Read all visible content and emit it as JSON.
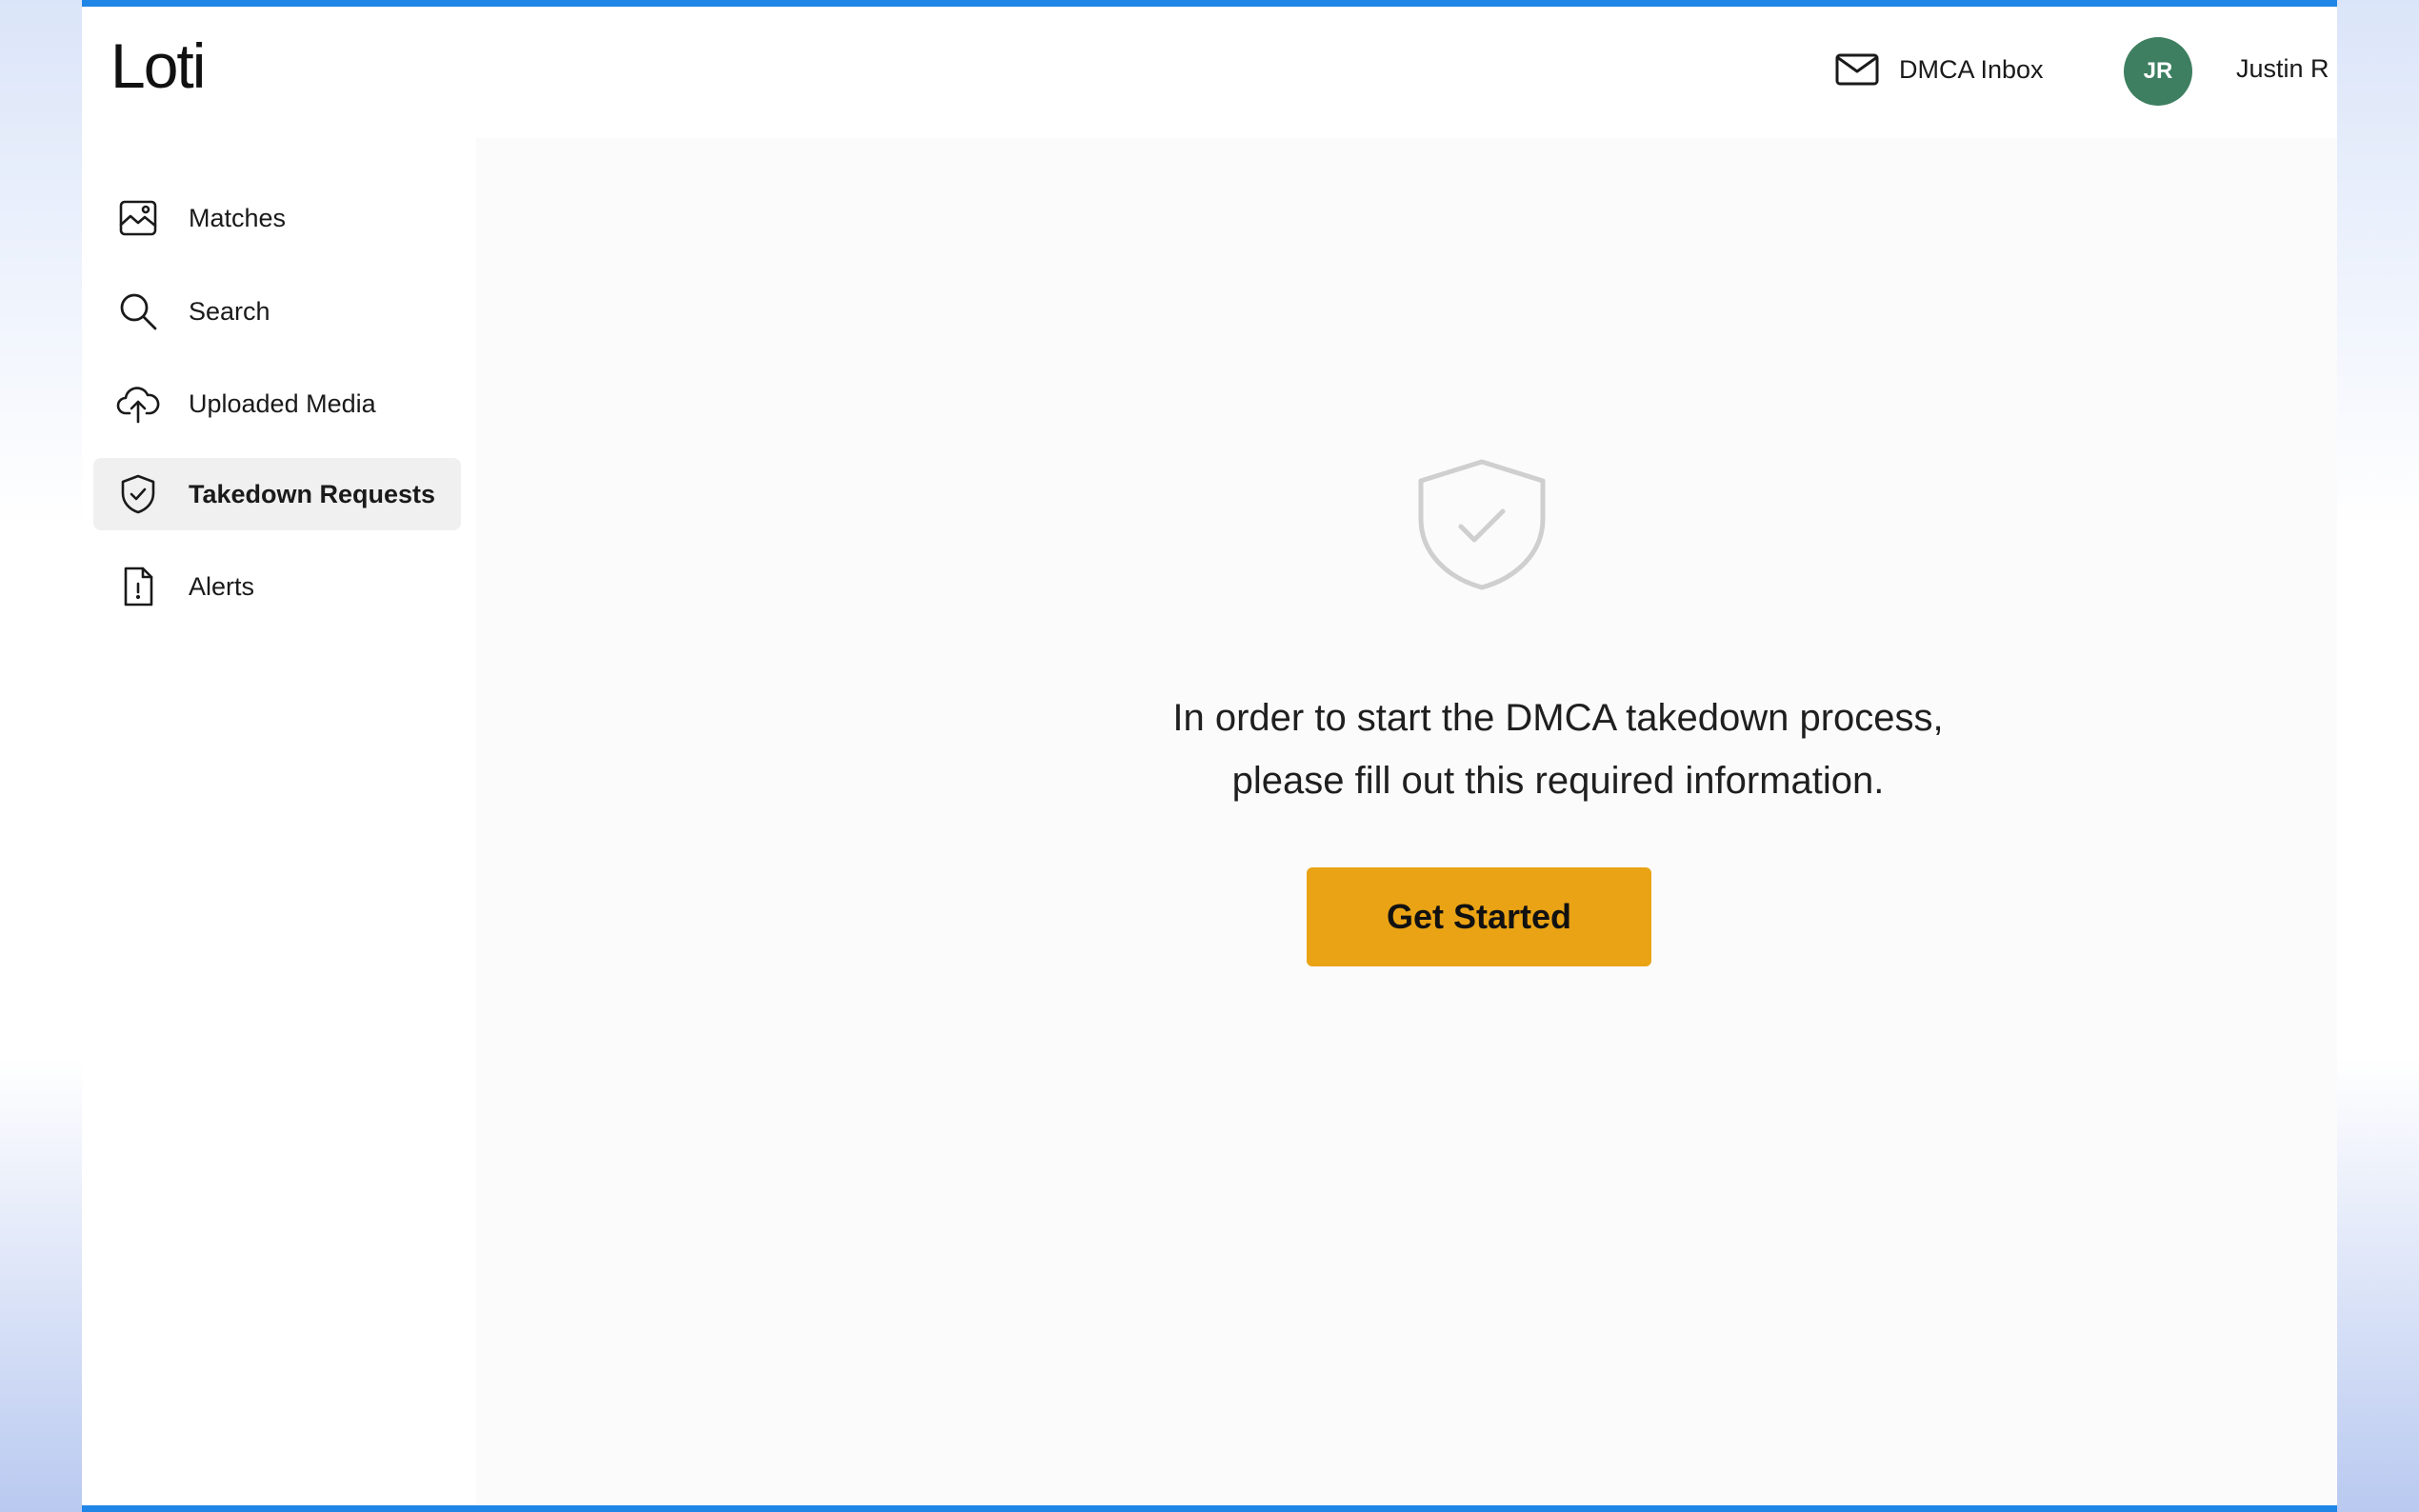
{
  "app": {
    "logo_text": "Loti",
    "accent_color": "#e9a315",
    "avatar_color": "#3d7f60"
  },
  "header": {
    "inbox_label": "DMCA Inbox",
    "inbox_icon": "mail-icon",
    "user_initials": "JR",
    "user_name": "Justin R"
  },
  "sidebar": {
    "items": [
      {
        "label": "Matches",
        "icon": "image-icon",
        "active": false
      },
      {
        "label": "Search",
        "icon": "search-icon",
        "active": false
      },
      {
        "label": "Uploaded Media",
        "icon": "cloud-upload-icon",
        "active": false
      },
      {
        "label": "Takedown Requests",
        "icon": "shield-check-icon",
        "active": true
      },
      {
        "label": "Alerts",
        "icon": "document-alert-icon",
        "active": false
      }
    ]
  },
  "main": {
    "illustration_icon": "shield-check-icon",
    "message_line1": "In order to start the DMCA takedown process,",
    "message_line2": "please fill out this required information.",
    "cta_label": "Get Started"
  }
}
